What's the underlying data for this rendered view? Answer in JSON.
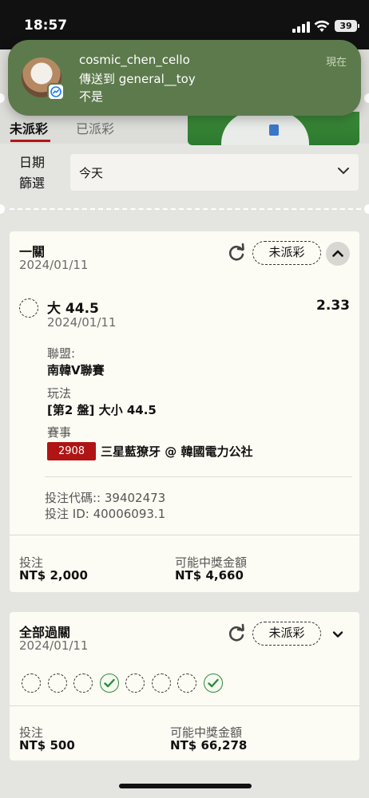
{
  "status_bar": {
    "time": "18:57",
    "battery": "39",
    "icons": [
      "signal-icon",
      "wifi-icon",
      "battery-icon"
    ]
  },
  "notification": {
    "sender": "cosmic_chen_cello",
    "title": "傳送到 general__toy",
    "body": "不是",
    "time": "現在",
    "app_icon": "messenger-icon"
  },
  "tabs": [
    {
      "label": "未派彩",
      "active": true
    },
    {
      "label": "已派彩",
      "active": false
    }
  ],
  "date_filter": {
    "label": "日期篩選",
    "label_line1": "日期",
    "label_line2": "篩選",
    "value": "今天"
  },
  "colors": {
    "accent": "#b31616",
    "card_bg": "#fdfcf4",
    "won_green": "#2f8a3a",
    "notification_bg": "#5d7a4c"
  },
  "bets": [
    {
      "type": "一關",
      "date": "2024/01/11",
      "status": "未派彩",
      "expanded": true,
      "selection": {
        "name": "大 44.5",
        "date": "2024/01/11",
        "odds": "2.33",
        "league_label": "聯盟:",
        "league": "南韓V聯賽",
        "market_label": "玩法",
        "market": "[第2 盤] 大小 44.5",
        "event_label": "賽事",
        "event_id": "2908",
        "event": "三星藍獠牙 @ 韓國電力公社"
      },
      "bet_code": "投注代碼:: 39402473",
      "bet_id": "投注 ID: 40006093.1",
      "stake_label": "投注",
      "stake": "NT$ 2,000",
      "payout_label": "可能中獎金額",
      "payout": "NT$ 4,660"
    },
    {
      "type": "全部過關",
      "date": "2024/01/11",
      "status": "未派彩",
      "expanded": false,
      "legs": [
        "pending",
        "pending",
        "pending",
        "won",
        "pending",
        "pending",
        "pending",
        "won"
      ],
      "stake_label": "投注",
      "stake": "NT$ 500",
      "payout_label": "可能中獎金額",
      "payout": "NT$ 66,278"
    }
  ]
}
